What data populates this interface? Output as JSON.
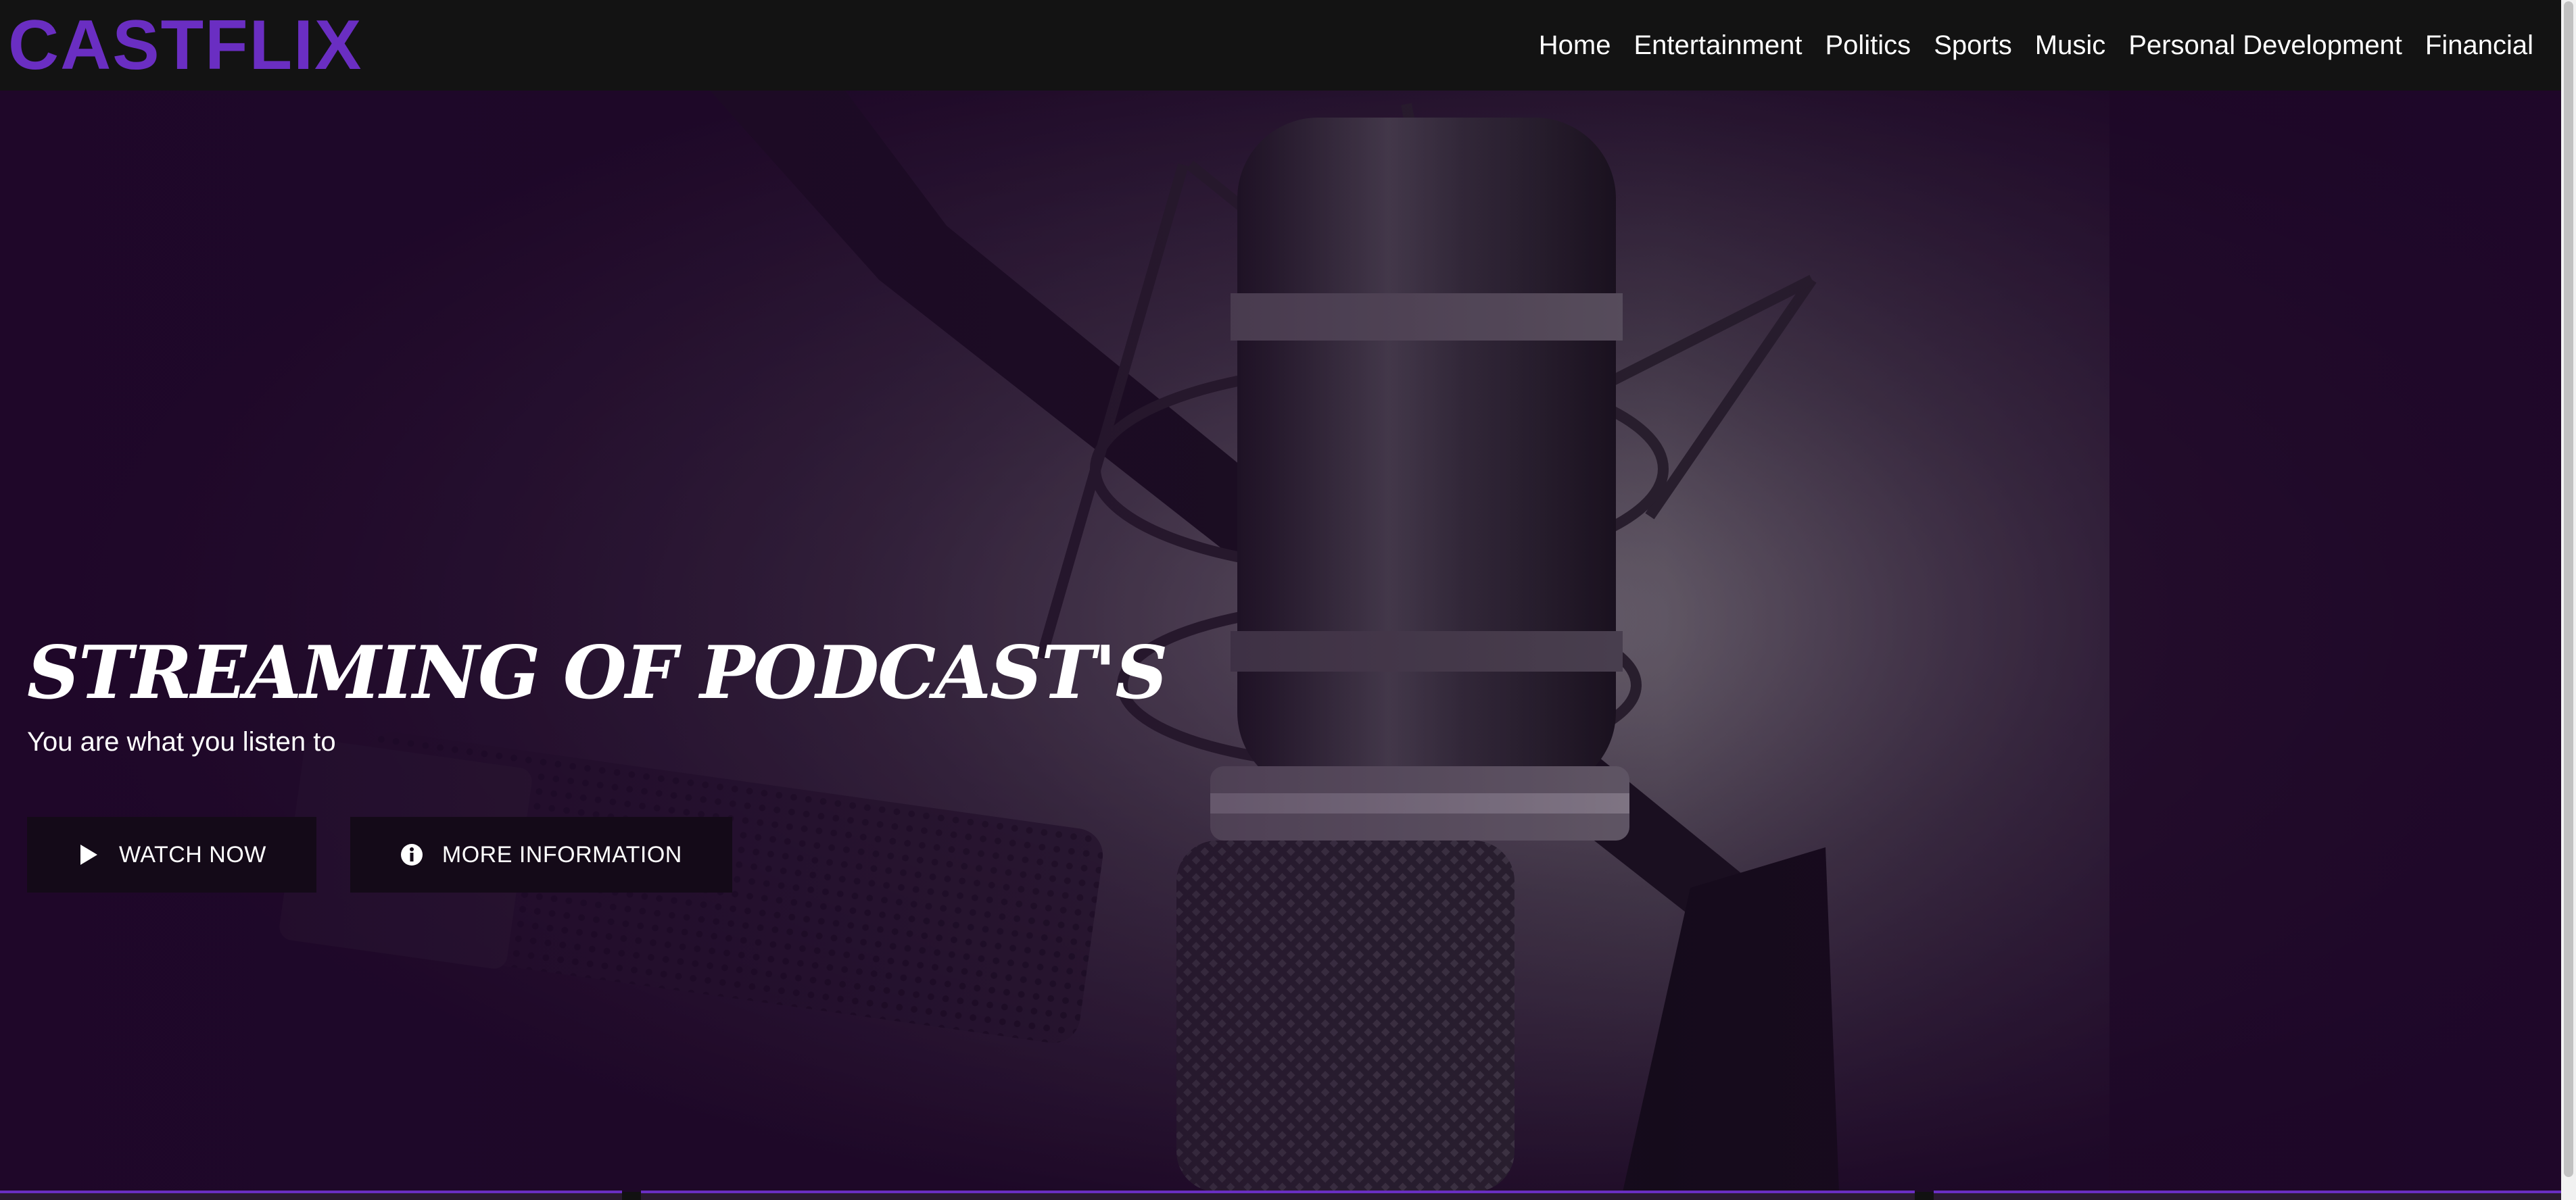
{
  "brand": {
    "logo_text": "CASTFLIX",
    "accent_color": "#6a2ec2"
  },
  "nav": {
    "items": [
      {
        "label": "Home"
      },
      {
        "label": "Entertainment"
      },
      {
        "label": "Politics"
      },
      {
        "label": "Sports"
      },
      {
        "label": "Music"
      },
      {
        "label": "Personal Development"
      },
      {
        "label": "Financial"
      }
    ]
  },
  "hero": {
    "title": "STREAMING OF PODCAST'S",
    "subtitle": "You are what you listen to",
    "background_image": "studio-microphone-photo",
    "overlay_color": "#1d0727",
    "buttons": {
      "watch_label": "WATCH NOW",
      "watch_icon": "play-icon",
      "info_label": "MORE INFORMATION",
      "info_icon": "info-icon"
    }
  }
}
